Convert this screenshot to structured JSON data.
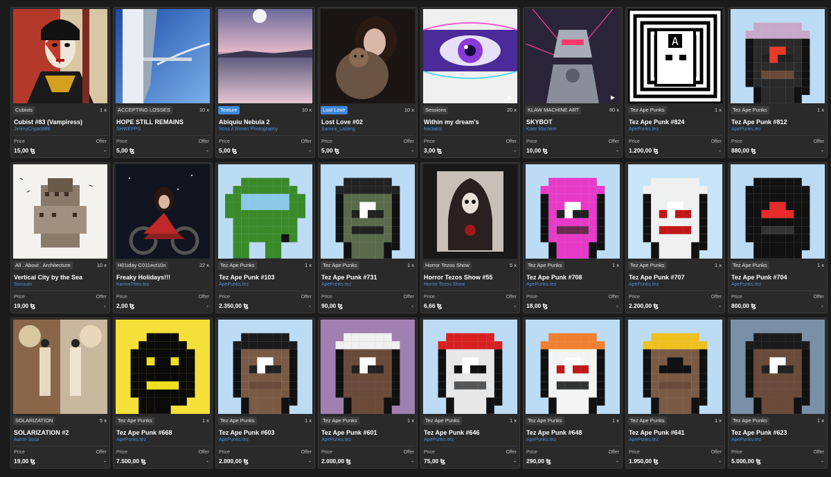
{
  "labels": {
    "price": "Price",
    "offer": "Offer"
  },
  "cards": [
    {
      "tag": "Cubists",
      "tag_style": "gray",
      "qty": "1 x",
      "title": "Cubist #83 (Vampiress)",
      "creator": "JimmyCrypto888",
      "price": "15,00 ꜩ",
      "offer": "-",
      "art": "cubist"
    },
    {
      "tag": "ACCEPTING LOSSES",
      "tag_style": "gray",
      "qty": "10 x",
      "title": "HOPE STILL REMAINS",
      "creator": "SHWEPPS",
      "price": "5,00 ꜩ",
      "offer": "-",
      "art": "building"
    },
    {
      "tag": "Texture",
      "tag_style": "blue",
      "qty": "10 x",
      "title": "Abiquiu Nebula 2",
      "creator": "Ross A Brown Photography",
      "price": "5,00 ꜩ",
      "offer": "-",
      "art": "lake"
    },
    {
      "tag": "Lost Love",
      "tag_style": "blue",
      "qty": "10 x",
      "title": "Lost Love #02",
      "creator": "Samira_Lasting",
      "price": "5,00 ꜩ",
      "offer": "-",
      "art": "woman_cat"
    },
    {
      "tag": "Sessions",
      "tag_style": "gray",
      "qty": "20 x",
      "title": "Within my dream's",
      "creator": "fractalist",
      "price": "3,00 ꜩ",
      "offer": "-",
      "art": "eye",
      "video": true
    },
    {
      "tag": "KLAW MACHINE ART",
      "tag_style": "gray",
      "qty": "80 x",
      "title": "SKYBOT",
      "creator": "Klaw Machine",
      "price": "10,00 ꜩ",
      "offer": "-",
      "art": "robot",
      "video": true
    },
    {
      "tag": "Tez Ape Punks",
      "tag_style": "gray",
      "qty": "1 x",
      "title": "Tez Ape Punk #824",
      "creator": "ApePunks.tez",
      "price": "1.200,00 ꜩ",
      "offer": "-",
      "art": "punk_maze"
    },
    {
      "tag": "Tez Ape Punks",
      "tag_style": "gray",
      "qty": "1 x",
      "title": "Tez Ape Punk #812",
      "creator": "ApePunks.tez",
      "price": "880,00 ꜩ",
      "offer": "-",
      "art": "punk_brain"
    },
    {
      "tag": "All . About . Architecture",
      "tag_style": "gray",
      "qty": "10 x",
      "title": "Vertical City by the Sea",
      "creator": "Soroush",
      "price": "19,00 ꜩ",
      "offer": "-",
      "art": "city"
    },
    {
      "tag": "H01iday C011ect10n",
      "tag_style": "gray",
      "qty": "22 x",
      "title": "Freaky Holidays!!!",
      "creator": "KarinaTheo.tez",
      "price": "2,00 ꜩ",
      "offer": "-",
      "art": "biker"
    },
    {
      "tag": "Tez Ape Punks",
      "tag_style": "gray",
      "qty": "1 x",
      "title": "Tez Ape Punk #103",
      "creator": "ApePunks.tez",
      "price": "2.350,00 ꜩ",
      "offer": "-",
      "art": "punk_green"
    },
    {
      "tag": "Tez Ape Punks",
      "tag_style": "gray",
      "qty": "1 x",
      "title": "Tez Ape Punk #731",
      "creator": "ApePunks.tez",
      "price": "90,00 ꜩ",
      "offer": "-",
      "art": "punk_cap"
    },
    {
      "tag": "Horror Tezos Show",
      "tag_style": "gray",
      "qty": "5 x",
      "title": "Horror Tezos Show #55",
      "creator": "Horror Tezos Show",
      "price": "6,66 ꜩ",
      "offer": "-",
      "art": "reaper"
    },
    {
      "tag": "Tez Ape Punks",
      "tag_style": "gray",
      "qty": "1 x",
      "title": "Tez Ape Punk #708",
      "creator": "ApePunks.tez",
      "price": "18,00 ꜩ",
      "offer": "-",
      "art": "punk_pink"
    },
    {
      "tag": "Tez Ape Punks",
      "tag_style": "gray",
      "qty": "1 x",
      "title": "Tez Ape Punk #707",
      "creator": "ApePunks.tez",
      "price": "2.200,00 ꜩ",
      "offer": "-",
      "art": "punk_skull_red"
    },
    {
      "tag": "Tez Ape Punks",
      "tag_style": "gray",
      "qty": "1 x",
      "title": "Tez Ape Punk #704",
      "creator": "ApePunks.tez",
      "price": "800,00 ꜩ",
      "offer": "-",
      "art": "punk_hood"
    },
    {
      "tag": "SOLARIZATION",
      "tag_style": "gray",
      "qty": "5 x",
      "title": "SOLARIZATION #2",
      "creator": "Aaron Sosa",
      "price": "19,00 ꜩ",
      "offer": "-",
      "art": "solar"
    },
    {
      "tag": "Tez Ape Punks",
      "tag_style": "gray",
      "qty": "1 x",
      "title": "Tez Ape Punk #668",
      "creator": "ApePunks.tez",
      "price": "7.500,00 ꜩ",
      "offer": "-",
      "art": "punk_black"
    },
    {
      "tag": "Tez Ape Punks",
      "tag_style": "gray",
      "qty": "1 x",
      "title": "Tez Ape Punk #603",
      "creator": "ApePunks.tez",
      "price": "2.000,00 ꜩ",
      "offer": "-",
      "art": "punk_ape_hair"
    },
    {
      "tag": "Tez Ape Punks",
      "tag_style": "gray",
      "qty": "1 x",
      "title": "Tez Ape Punk #601",
      "creator": "ApePunks.tez",
      "price": "2.000,00 ꜩ",
      "offer": "-",
      "art": "punk_ape_white"
    },
    {
      "tag": "Tez Ape Punks",
      "tag_style": "gray",
      "qty": "1 x",
      "title": "Tez Ape Punk #646",
      "creator": "ApePunks.tez",
      "price": "75,00 ꜩ",
      "offer": "-",
      "art": "punk_mohawk"
    },
    {
      "tag": "Tez Ape Punks",
      "tag_style": "gray",
      "qty": "1 x",
      "title": "Tez Ape Punk #648",
      "creator": "ApePunks.tez",
      "price": "290,00 ꜩ",
      "offer": "-",
      "art": "punk_skull"
    },
    {
      "tag": "Tez Ape Punks",
      "tag_style": "gray",
      "qty": "1 x",
      "title": "Tez Ape Punk #641",
      "creator": "ApePunks.tez",
      "price": "1.950,00 ꜩ",
      "offer": "-",
      "art": "punk_crown"
    },
    {
      "tag": "Tez Ape Punks",
      "tag_style": "gray",
      "qty": "1 x",
      "title": "Tez Ape Punk #623",
      "creator": "ApePunks.tez",
      "price": "5.000,00 ꜩ",
      "offer": "-",
      "art": "punk_ape_hood"
    }
  ]
}
